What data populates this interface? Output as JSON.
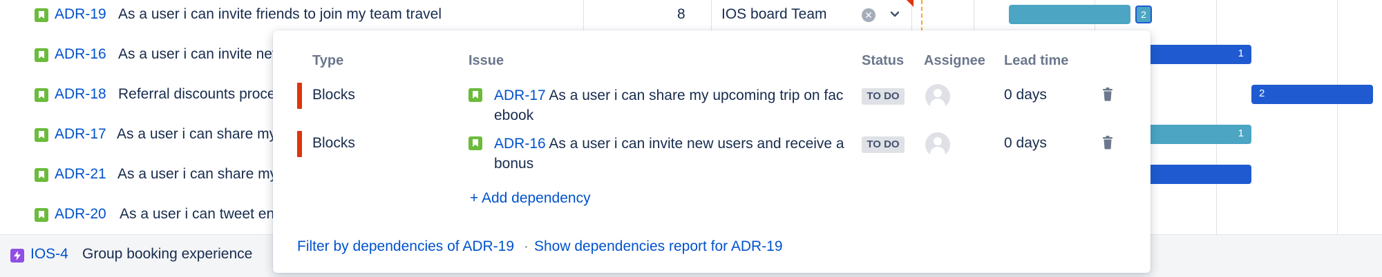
{
  "rows": [
    {
      "key": "ADR-19",
      "summary": "As a user i can invite friends to join my team travel"
    },
    {
      "key": "ADR-16",
      "summary": "As a user i can invite nev"
    },
    {
      "key": "ADR-18",
      "summary": "Referral discounts proce"
    },
    {
      "key": "ADR-17",
      "summary": "As a user i can share my"
    },
    {
      "key": "ADR-21",
      "summary": "As a user i can share my"
    },
    {
      "key": "ADR-20",
      "summary": "As a user i can tweet en"
    }
  ],
  "first_row": {
    "estimate": "8",
    "team": "IOS board Team",
    "clear_glyph": "✕"
  },
  "epic": {
    "key": "IOS-4",
    "title": "Group booking experience"
  },
  "timeline": {
    "badge_row1": "2",
    "bar_counts": [
      "1",
      "2",
      "1"
    ],
    "colors": {
      "teal": "#4ba5c3",
      "blue": "#1f5ad1",
      "today_line": "#f5a623"
    }
  },
  "popup": {
    "headers": {
      "type": "Type",
      "issue": "Issue",
      "status": "Status",
      "assignee": "Assignee",
      "lead_time": "Lead time"
    },
    "dependencies": [
      {
        "type": "Blocks",
        "key": "ADR-17",
        "summary": "As a user i can share my upcoming trip on facebook",
        "status": "TO DO",
        "lead_time": "0 days"
      },
      {
        "type": "Blocks",
        "key": "ADR-16",
        "summary": "As a user i can invite new users and receive a bonus",
        "status": "TO DO",
        "lead_time": "0 days"
      }
    ],
    "add_dependency": "+ Add dependency",
    "footer": {
      "filter_link": "Filter by dependencies of ADR-19",
      "separator": "·",
      "report_link": "Show dependencies report for ADR-19"
    }
  },
  "icons": [
    "story-icon",
    "epic-icon",
    "clear-icon",
    "chevron-down-icon",
    "avatar-placeholder-icon",
    "trash-icon"
  ]
}
